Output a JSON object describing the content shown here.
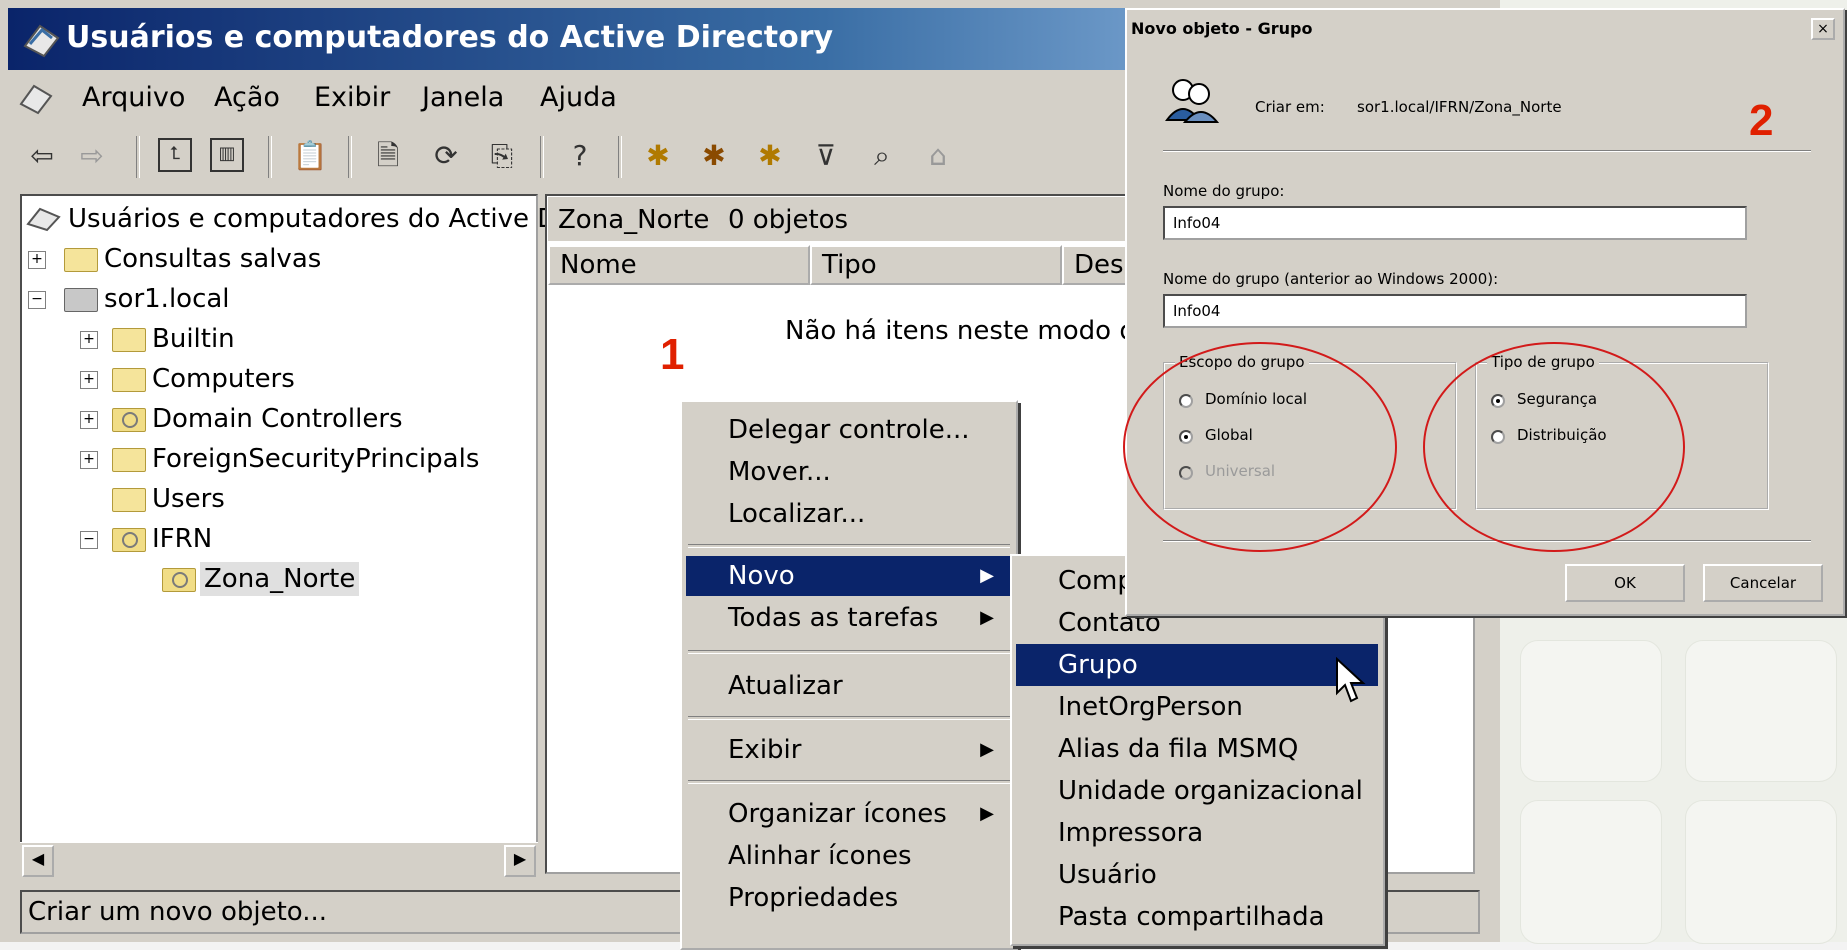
{
  "window": {
    "title": "Usuários e computadores do Active Directory"
  },
  "menubar": {
    "items": [
      "Arquivo",
      "Ação",
      "Exibir",
      "Janela",
      "Ajuda"
    ]
  },
  "toolbar": {
    "icons": [
      "back-icon",
      "forward-icon",
      "up-folder-icon",
      "show-tree-icon",
      "paste-icon",
      "properties-icon",
      "refresh-icon",
      "export-icon",
      "help-icon",
      "new-user-icon",
      "new-group-icon",
      "new-ou-icon",
      "filter-icon",
      "find-icon",
      "add-to-group-icon"
    ]
  },
  "tree": {
    "root": "Usuários e computadores do Active Di",
    "items": [
      {
        "label": "Consultas salvas"
      },
      {
        "label": "sor1.local"
      },
      {
        "label": "Builtin"
      },
      {
        "label": "Computers"
      },
      {
        "label": "Domain Controllers"
      },
      {
        "label": "ForeignSecurityPrincipals"
      },
      {
        "label": "Users"
      },
      {
        "label": "IFRN"
      },
      {
        "label": "Zona_Norte"
      }
    ]
  },
  "list": {
    "location": "Zona_Norte",
    "count": "0 objetos",
    "columns": [
      "Nome",
      "Tipo",
      "Desc"
    ],
    "empty_message": "Não há itens neste modo de"
  },
  "status": {
    "text": "Criar um novo objeto..."
  },
  "markers": {
    "one": "1",
    "two": "2"
  },
  "context_menu": {
    "items": [
      "Delegar controle...",
      "Mover...",
      "Localizar...",
      "Novo",
      "Todas as tarefas",
      "Atualizar",
      "Exibir",
      "Organizar ícones",
      "Alinhar ícones",
      "Propriedades"
    ]
  },
  "submenu": {
    "items": [
      "Comp",
      "Contato",
      "Grupo",
      "InetOrgPerson",
      "Alias da fila MSMQ",
      "Unidade organizacional",
      "Impressora",
      "Usuário",
      "Pasta compartilhada"
    ]
  },
  "dialog": {
    "title": "Novo objeto - Grupo",
    "close": "×",
    "create_in_label": "Criar em:",
    "create_in_value": "sor1.local/IFRN/Zona_Norte",
    "group_name_label": "Nome do grupo:",
    "group_name_value": "Info04",
    "pre2000_label": "Nome do grupo (anterior ao Windows 2000):",
    "pre2000_value": "Info04",
    "scope_title": "Escopo do grupo",
    "scope_options": [
      "Domínio local",
      "Global",
      "Universal"
    ],
    "type_title": "Tipo de grupo",
    "type_options": [
      "Segurança",
      "Distribuição"
    ],
    "ok": "OK",
    "cancel": "Cancelar"
  },
  "colors": {
    "highlight": "#0a246a",
    "annotation_red": "#e02000"
  }
}
